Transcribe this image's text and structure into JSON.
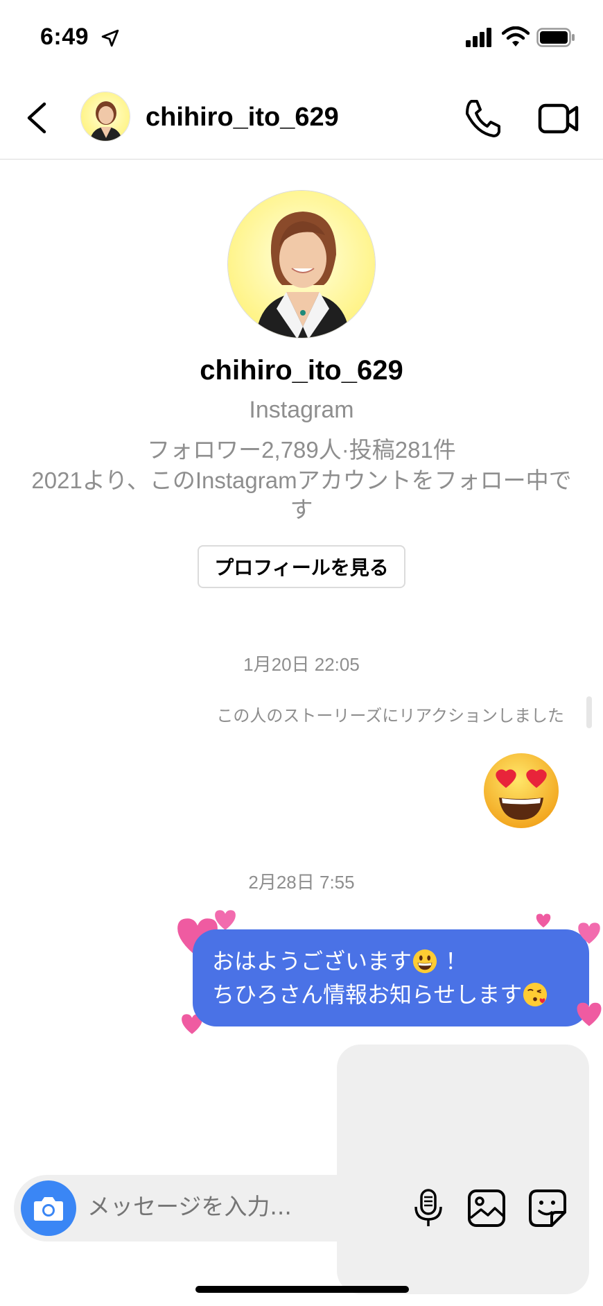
{
  "status_bar": {
    "time": "6:49"
  },
  "header": {
    "username": "chihiro_ito_629"
  },
  "profile": {
    "username": "chihiro_ito_629",
    "platform": "Instagram",
    "stats": "フォロワー2,789人·投稿281件",
    "follow_info": "2021より、このInstagramアカウントをフォロー中です",
    "view_profile_label": "プロフィールを見る"
  },
  "messages": {
    "timestamp_1": "1月20日 22:05",
    "story_reaction": "この人のストーリーズにリアクションしました",
    "reaction_emoji": "heart-eyes-emoji",
    "timestamp_2": "2月28日 7:55",
    "bubble_line1": "おはようございます",
    "bubble_line1_after": " ！",
    "bubble_line2": "ちひろさん情報お知らせします",
    "bubble_color": "#4a72e6"
  },
  "composer": {
    "placeholder": "メッセージを入力..."
  },
  "colors": {
    "accent_blue": "#3a86f5",
    "heart_pink": "#ef5ba1",
    "muted_text": "#8e8e8e"
  }
}
